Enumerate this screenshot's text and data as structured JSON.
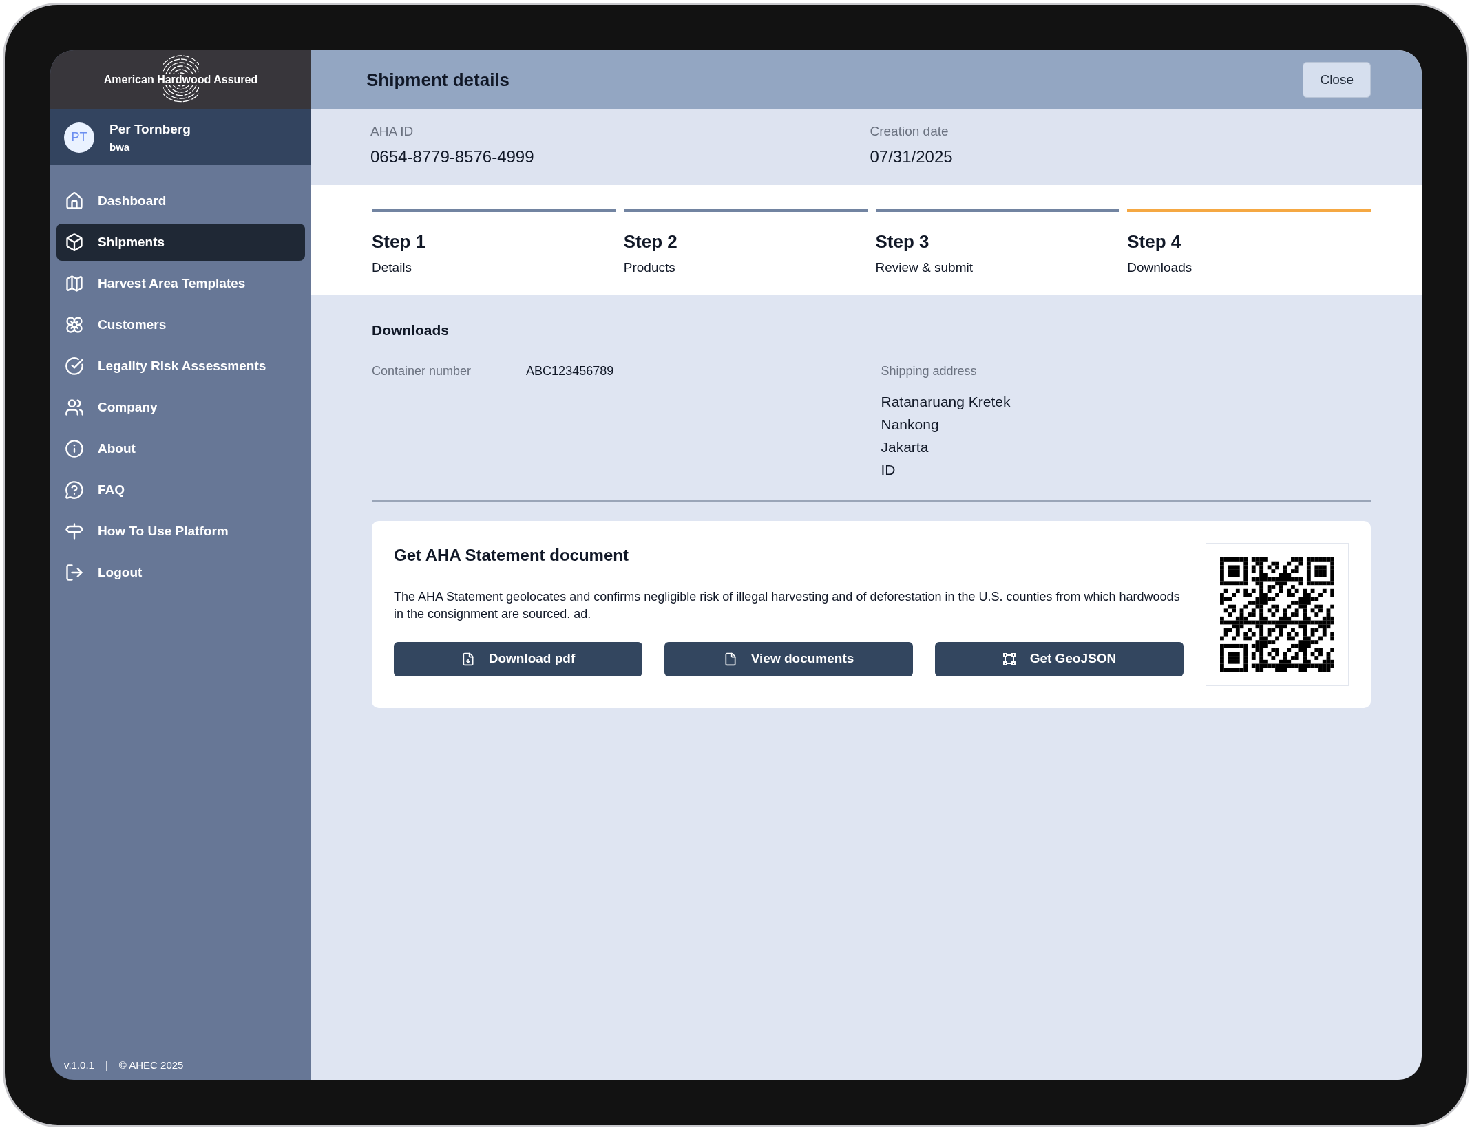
{
  "brand": {
    "name": "American Hardwood Assured"
  },
  "user": {
    "initials": "PT",
    "name": "Per Tornberg",
    "org": "bwa"
  },
  "nav": [
    {
      "label": "Dashboard",
      "selected": false
    },
    {
      "label": "Shipments",
      "selected": true
    },
    {
      "label": "Harvest Area Templates",
      "selected": false
    },
    {
      "label": "Customers",
      "selected": false
    },
    {
      "label": "Legality Risk Assessments",
      "selected": false
    },
    {
      "label": "Company",
      "selected": false
    },
    {
      "label": "About",
      "selected": false
    },
    {
      "label": "FAQ",
      "selected": false
    },
    {
      "label": "How To Use Platform",
      "selected": false
    },
    {
      "label": "Logout",
      "selected": false
    }
  ],
  "footer": {
    "version": "v.1.0.1",
    "separator": "|",
    "copyright": "© AHEC 2025"
  },
  "header": {
    "title": "Shipment details",
    "close": "Close"
  },
  "info": [
    {
      "label": "AHA ID",
      "value": "0654-8779-8576-4999"
    },
    {
      "label": "Creation date",
      "value": "07/31/2025"
    }
  ],
  "steps": [
    {
      "title": "Step 1",
      "subtitle": "Details",
      "selected": false
    },
    {
      "title": "Step 2",
      "subtitle": "Products",
      "selected": false
    },
    {
      "title": "Step 3",
      "subtitle": "Review & submit",
      "selected": false
    },
    {
      "title": "Step 4",
      "subtitle": "Downloads",
      "selected": true
    }
  ],
  "downloads": {
    "title": "Downloads",
    "container_label": "Container number",
    "container_value": "ABC123456789",
    "address_label": "Shipping address",
    "address_lines": [
      "Ratanaruang Kretek",
      "Nankong",
      "Jakarta",
      "ID"
    ]
  },
  "statement": {
    "title": "Get AHA Statement document",
    "description": "The AHA Statement geolocates and confirms negligible risk of illegal harvesting and of deforestation in the U.S. counties from which hardwoods in the consignment are sourced. ad.",
    "buttons": [
      "Download pdf",
      "View documents",
      "Get GeoJSON"
    ]
  }
}
